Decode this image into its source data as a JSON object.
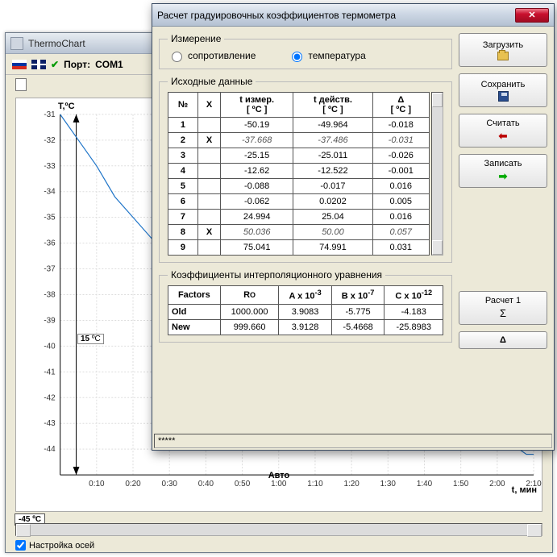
{
  "back": {
    "title": "ThermoChart",
    "port_prefix": "Порт:",
    "port_value": "COM1",
    "settings_checkbox": "Настройка осей",
    "y_axis_label": "T,ºC",
    "x_axis_label": "t, мин",
    "auto_label": "Авто",
    "cursor_value": "15",
    "cursor_unit": "ºC",
    "y_badge": "-45",
    "y_badge_unit": "ºC",
    "y_ticks": [
      "-31",
      "-32",
      "-33",
      "-34",
      "-35",
      "-36",
      "-37",
      "-38",
      "-39",
      "-40",
      "-41",
      "-42",
      "-43",
      "-44"
    ],
    "x_ticks": [
      "0:10",
      "0:20",
      "0:30",
      "0:40",
      "0:50",
      "1:00",
      "1:10",
      "1:20",
      "1:30",
      "1:40",
      "1:50",
      "2:00",
      "2:10"
    ]
  },
  "dlg": {
    "title": "Расчет градуировочных коэффициентов термометра",
    "measure_legend": "Измерение",
    "resistance": "сопротивление",
    "temperature": "температура",
    "source_legend": "Исходные данные",
    "coef_legend": "Коэффициенты интерполяционного уравнения",
    "status": "*****",
    "headers": {
      "n": "№",
      "x": "X",
      "tmeas": "t измер.\n[ ºC ]",
      "tact": "t действ.\n[ ºC ]",
      "delta": "Δ\n[ ºC ]"
    },
    "rows": [
      {
        "n": "1",
        "x": "",
        "tm": "-50.19",
        "ta": "-49.964",
        "d": "-0.018",
        "ex": false
      },
      {
        "n": "2",
        "x": "X",
        "tm": "-37.668",
        "ta": "-37.486",
        "d": "-0.031",
        "ex": true
      },
      {
        "n": "3",
        "x": "",
        "tm": "-25.15",
        "ta": "-25.011",
        "d": "-0.026",
        "ex": false
      },
      {
        "n": "4",
        "x": "",
        "tm": "-12.62",
        "ta": "-12.522",
        "d": "-0.001",
        "ex": false
      },
      {
        "n": "5",
        "x": "",
        "tm": "-0.088",
        "ta": "-0.017",
        "d": "0.016",
        "ex": false
      },
      {
        "n": "6",
        "x": "",
        "tm": "-0.062",
        "ta": "0.0202",
        "d": "0.005",
        "ex": false
      },
      {
        "n": "7",
        "x": "",
        "tm": "24.994",
        "ta": "25.04",
        "d": "0.016",
        "ex": false
      },
      {
        "n": "8",
        "x": "X",
        "tm": "50.036",
        "ta": "50.00",
        "d": "0.057",
        "ex": true
      },
      {
        "n": "9",
        "x": "",
        "tm": "75.041",
        "ta": "74.991",
        "d": "0.031",
        "ex": false
      }
    ],
    "coef_headers": {
      "factors": "Factors",
      "r0": "R₀",
      "a": "A x 10⁻³",
      "b": "B x 10⁻⁷",
      "c": "C x 10⁻¹²"
    },
    "coef_rows": [
      {
        "name": "Old",
        "r0": "1000.000",
        "a": "3.9083",
        "b": "-5.775",
        "c": "-4.183"
      },
      {
        "name": "New",
        "r0": "999.660",
        "a": "3.9128",
        "b": "-5.4668",
        "c": "-25.8983"
      }
    ],
    "buttons": {
      "load": "Загрузить",
      "save": "Сохранить",
      "read": "Считать",
      "write": "Записать",
      "calc": "Расчет 1",
      "sigma": "Σ",
      "delta": "Δ"
    }
  },
  "chart_data": {
    "type": "line",
    "title": "",
    "xlabel": "t, мин",
    "ylabel": "T,ºC",
    "ylim": [
      -45,
      -31
    ],
    "xlim": [
      0,
      130
    ],
    "x_unit": "seconds",
    "x": [
      0,
      5,
      10,
      15,
      20,
      25,
      30,
      35,
      40,
      60,
      80,
      100,
      120,
      128,
      130
    ],
    "values": [
      -31.0,
      -32.0,
      -33.0,
      -34.2,
      -35.0,
      -35.8,
      -36.3,
      -37.0,
      -37.9,
      -38.0,
      -38.0,
      -38.0,
      -43.4,
      -44.2,
      -44.2
    ]
  }
}
